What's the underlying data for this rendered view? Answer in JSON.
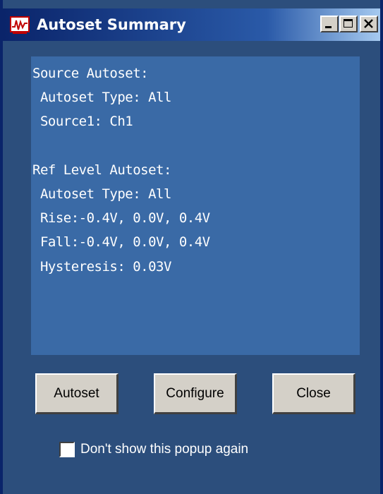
{
  "window": {
    "title": "Autoset Summary",
    "icon": "oscilloscope-app-icon",
    "controls": [
      "minimize-icon",
      "maximize-icon",
      "close-icon"
    ]
  },
  "summary": {
    "lines": [
      "Source Autoset:",
      " Autoset Type: All",
      " Source1: Ch1",
      "",
      "Ref Level Autoset:",
      " Autoset Type: All",
      " Rise:-0.4V, 0.0V, 0.4V",
      " Fall:-0.4V, 0.0V, 0.4V",
      " Hysteresis: 0.03V"
    ]
  },
  "buttons": {
    "autoset": "Autoset",
    "configure": "Configure",
    "close": "Close"
  },
  "checkbox": {
    "label": "Don't show this popup again",
    "checked": false
  },
  "colors": {
    "window_bg": "#2c4e7c",
    "panel_bg": "#3a6aa6",
    "titlebar_start": "#0a246a",
    "titlebar_end": "#a6caf0",
    "button_face": "#d4d0c8"
  }
}
